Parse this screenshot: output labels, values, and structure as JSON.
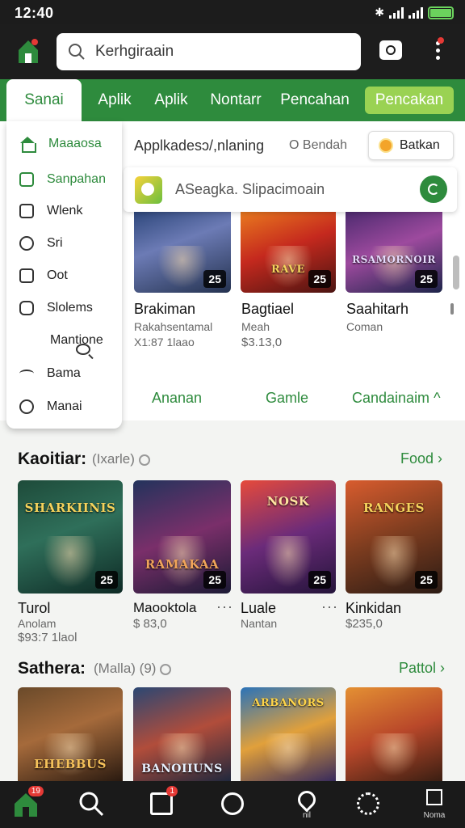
{
  "status": {
    "time": "12:40"
  },
  "search": {
    "text": "Kerhgiraain"
  },
  "tabs": [
    {
      "label": "Sanai"
    },
    {
      "label": "Aplik"
    },
    {
      "label": "Aplik"
    },
    {
      "label": "Nontarr"
    },
    {
      "label": "Pencahan"
    },
    {
      "label": "Pencakan"
    }
  ],
  "dropdown": {
    "items": [
      {
        "label": "Maaaosa",
        "icon": "home-icon"
      },
      {
        "label": "Sanpahan",
        "icon": "mail-icon"
      },
      {
        "label": "Wlenk",
        "icon": "square-icon"
      },
      {
        "label": "Sri",
        "icon": "circle-icon"
      },
      {
        "label": "Oot",
        "icon": "envelope-icon"
      },
      {
        "label": "Slolems",
        "icon": "shield-icon"
      },
      {
        "label": "Mantione",
        "icon": "search-icon"
      },
      {
        "label": "Bama",
        "icon": "wave-icon"
      },
      {
        "label": "Manai",
        "icon": "circle-icon"
      }
    ]
  },
  "panel": {
    "heading": "Applkadesɔ/,nlaning",
    "filter": "O Bendah",
    "action": "Batkan",
    "suggestion": "ASeagka. Slipacimoain"
  },
  "featured": [
    {
      "title": "Brakiman",
      "meta1": "Rakahsentamal",
      "meta2": "X1:87 1laao",
      "badge": "25"
    },
    {
      "title": "Bagtiael",
      "meta1": "Meah",
      "meta2": "$3.13,0",
      "badge": "25",
      "art_title": "RAVE"
    },
    {
      "title": "Saahitarh",
      "meta1": "Coman",
      "meta2": "",
      "badge": "25",
      "art_title": "RSAMORNOIR"
    }
  ],
  "categories": [
    "Ananan",
    "Gamle",
    "Candainaim"
  ],
  "section1": {
    "title": "Kaoitiar:",
    "sub": "(Ixarle)",
    "link": "Food",
    "items": [
      {
        "title": "Turol",
        "meta1": "Anolam",
        "meta2": "$93:7 1laol",
        "badge": "25",
        "art_title": "SHARKIINIS"
      },
      {
        "title": "Maooktola",
        "meta1": "$ 83,0",
        "meta2": "",
        "badge": "25",
        "art_title": "RAMAKAA"
      },
      {
        "title": "Luale",
        "meta1": "Nantan",
        "meta2": "",
        "badge": "25",
        "art_title": "NOSK"
      },
      {
        "title": "Kinkidan",
        "meta1": "$235,0",
        "meta2": "",
        "badge": "25",
        "art_title": "RANGES"
      }
    ]
  },
  "section2": {
    "title": "Sathera:",
    "sub": "(Malla) (9)",
    "link": "Pattol",
    "items": [
      {
        "art_title": "EHEBBUS"
      },
      {
        "art_title": "BANOIIUNS"
      },
      {
        "art_title": "ARBANORS"
      },
      {
        "art_title": ""
      }
    ]
  },
  "bottomnav": {
    "badge_home": "19",
    "badge_apps": "1",
    "label_last": "Noma",
    "label_5": "nil"
  }
}
